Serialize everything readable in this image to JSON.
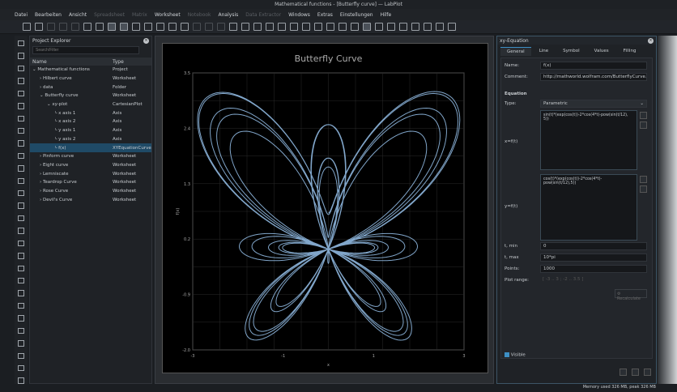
{
  "window": {
    "title": "Mathematical functions - [Butterfly curve] — LabPlot"
  },
  "menu": [
    {
      "label": "Datei",
      "enabled": true
    },
    {
      "label": "Bearbeiten",
      "enabled": true
    },
    {
      "label": "Ansicht",
      "enabled": true
    },
    {
      "label": "Spreadsheet",
      "enabled": false
    },
    {
      "label": "Matrix",
      "enabled": false
    },
    {
      "label": "Worksheet",
      "enabled": true
    },
    {
      "label": "Notebook",
      "enabled": false
    },
    {
      "label": "Analysis",
      "enabled": true
    },
    {
      "label": "Data Extractor",
      "enabled": false
    },
    {
      "label": "Windows",
      "enabled": true
    },
    {
      "label": "Extras",
      "enabled": true
    },
    {
      "label": "Einstellungen",
      "enabled": true
    },
    {
      "label": "Hilfe",
      "enabled": true
    }
  ],
  "explorer": {
    "title": "Project Explorer",
    "search_placeholder": "Search/Filter",
    "col_name": "Name",
    "col_type": "Type",
    "rows": [
      {
        "name": "Mathematical functions",
        "type": "Project",
        "level": 0,
        "expanded": true
      },
      {
        "name": "Hilbert curve",
        "type": "Worksheet",
        "level": 1
      },
      {
        "name": "data",
        "type": "Folder",
        "level": 1
      },
      {
        "name": "Butterfly curve",
        "type": "Worksheet",
        "level": 1,
        "expanded": true
      },
      {
        "name": "xy-plot",
        "type": "CartesianPlot",
        "level": 2,
        "expanded": true
      },
      {
        "name": "x axis 1",
        "type": "Axis",
        "level": 3
      },
      {
        "name": "x axis 2",
        "type": "Axis",
        "level": 3
      },
      {
        "name": "y axis 1",
        "type": "Axis",
        "level": 3
      },
      {
        "name": "y axis 2",
        "type": "Axis",
        "level": 3
      },
      {
        "name": "f(x)",
        "type": "XYEquationCurve",
        "level": 3,
        "selected": true
      },
      {
        "name": "Pinform curve",
        "type": "Worksheet",
        "level": 1
      },
      {
        "name": "Eight curve",
        "type": "Worksheet",
        "level": 1
      },
      {
        "name": "Lemniscate",
        "type": "Worksheet",
        "level": 1
      },
      {
        "name": "Teardrop Curve",
        "type": "Worksheet",
        "level": 1
      },
      {
        "name": "Rose Curve",
        "type": "Worksheet",
        "level": 1
      },
      {
        "name": "Devil's Curve",
        "type": "Worksheet",
        "level": 1
      }
    ]
  },
  "chart_data": {
    "type": "line",
    "title": "Butterfly Curve",
    "xlabel": "x",
    "ylabel": "f(x)",
    "xlim": [
      -3,
      3
    ],
    "ylim": [
      -2.0,
      3.5
    ],
    "xticks": [
      "-3",
      "-1",
      "1",
      "3"
    ],
    "yticks": [
      "3.5",
      "2.4",
      "1.3",
      "0.2",
      "-0.9",
      "-2.0"
    ],
    "grid": true,
    "equation": {
      "x": "sin(t)*(exp(cos(t))-2*cos(4*t)-pow(sin(t/12),5))",
      "y": "cos(t)*(exp(cos(t))-2*cos(4*t)-pow(sin(t/12),5))",
      "t_min": 0,
      "t_max": 31.4159,
      "points": 1000
    },
    "line_color": "#8fb8e0"
  },
  "props": {
    "title": "xy-Equation",
    "tabs": [
      "General",
      "Line",
      "Symbol",
      "Values",
      "Filling"
    ],
    "name_label": "Name:",
    "name": "f(x)",
    "comment_label": "Comment:",
    "comment": "http://mathworld.wolfram.com/ButterflyCurve.html",
    "section": "Equation",
    "type_label": "Type:",
    "type": "Parametric",
    "x_label": "x=f(t)",
    "x_expr": "sin(t)*(exp(cos(t))-2*cos(4*t)-pow(sin(t/12), 5))",
    "y_label": "y=f(t)",
    "y_expr": "cos(t)*(exp(cos(t))-2*cos(4*t)-pow(sin(t/12),5))",
    "tmin_label": "t, min",
    "tmin": "0",
    "tmax_label": "t, max",
    "tmax": "10*pi",
    "points_label": "Points:",
    "points": "1000",
    "range_label": "Plot range:",
    "range": "[ -3 .. 3 ; -2 .. 3.5 ]",
    "recalc": "Recalculate",
    "visible": "Visible"
  },
  "status": "Memory used 326 MB, peak 326 MB"
}
